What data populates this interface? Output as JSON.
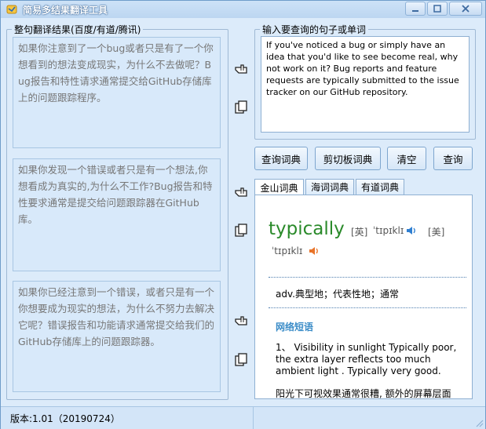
{
  "window": {
    "title": "简易多结果翻译工具"
  },
  "left_group": {
    "title": "整句翻译结果(百度/有道/腾讯)",
    "results": [
      "如果你注意到了一个bug或者只是有了一个你想看到的想法变成现实，为什么不去做呢？Bug报告和特性请求通常提交给GitHub存储库上的问题跟踪程序。",
      "如果你发现一个错误或者只是有一个想法,你想看成为真实的,为什么不工作?Bug报告和特性要求通常是提交给问题跟踪器在GitHub库。",
      "如果你已经注意到一个错误，或者只是有一个你想要成为现实的想法，为什么不努力去解决它呢？错误报告和功能请求通常提交给我们的GitHub存储库上的问题跟踪器。"
    ]
  },
  "input_group": {
    "title": "输入要查询的句子或单词",
    "text": "If you've noticed a bug or simply have an idea that you'd like to see become real, why not work on it? Bug reports and feature requests are typically submitted to the issue tracker on our GitHub repository."
  },
  "buttons": {
    "lookup_dict": "查询词典",
    "clipboard_dict": "剪切板词典",
    "clear": "清空",
    "query": "查询"
  },
  "tabs": [
    "金山词典",
    "海词词典",
    "有道词典"
  ],
  "dict": {
    "word": "typically",
    "uk_label": "[英]",
    "uk_phonetic": "ˈtɪpɪklɪ",
    "us_label": "[美]",
    "us_phonetic": "ˈtɪpɪklɪ",
    "meaning": "adv.典型地；代表性地；通常",
    "web_title": "网络短语",
    "example_en": "1、 Visibility in sunlight Typically poor, the extra layer reflects too much ambient light . Typically very good.",
    "example_zh": "阳光下可视效果通常很糟, 额外的屏幕层面"
  },
  "status": {
    "version": "版本:1.01（20190724）"
  },
  "colors": {
    "accent": "#2a8a2a",
    "web_title": "#3c8dc8",
    "speaker_blue": "#2f7fd1",
    "speaker_orange": "#e8742a"
  }
}
